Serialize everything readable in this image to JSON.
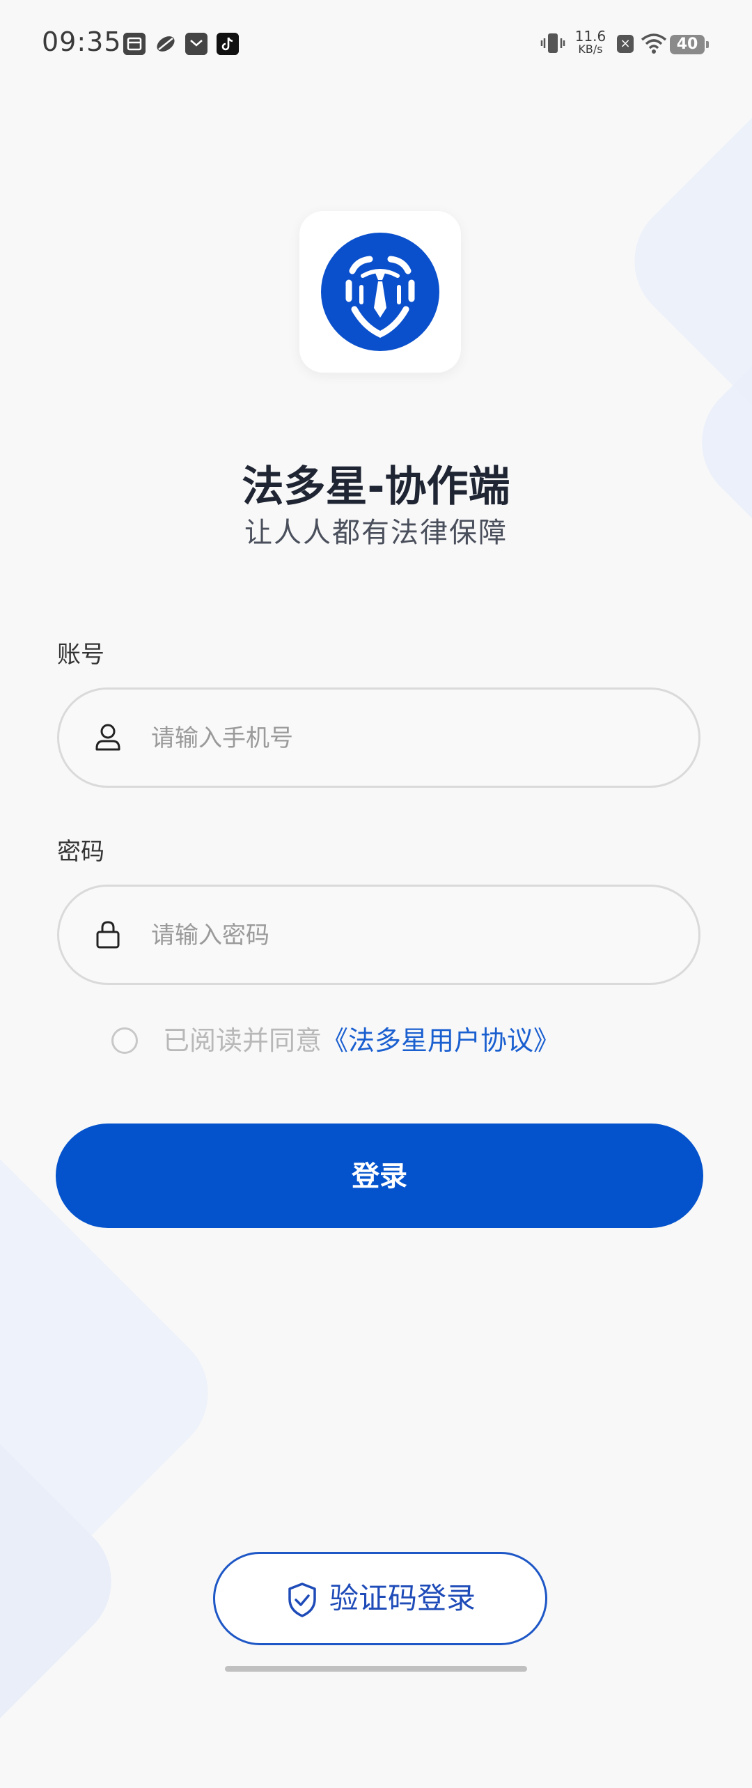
{
  "status_bar": {
    "time": "09:35",
    "net_speed_value": "11.6",
    "net_speed_unit": "KB/s",
    "battery": "40",
    "icons": [
      "calendar-app-icon",
      "leaf-app-icon",
      "mail-app-icon",
      "tiktok-icon",
      "vibrate-icon",
      "no-sim-icon",
      "wifi-icon",
      "battery-icon"
    ]
  },
  "app": {
    "title": "法多星-协作端",
    "subtitle": "让人人都有法律保障",
    "logo_icon": "shield-tie-logo",
    "brand_color": "#0453cc"
  },
  "form": {
    "account_label": "账号",
    "account_placeholder": "请输入手机号",
    "account_icon": "user-icon",
    "password_label": "密码",
    "password_placeholder": "请输入密码",
    "password_icon": "lock-icon",
    "agree_prefix": "已阅读并同意",
    "agree_link": "《法多星用户协议》",
    "agree_checked": false
  },
  "actions": {
    "login_label": "登录",
    "sms_login_label": "验证码登录",
    "sms_icon": "shield-check-icon"
  }
}
